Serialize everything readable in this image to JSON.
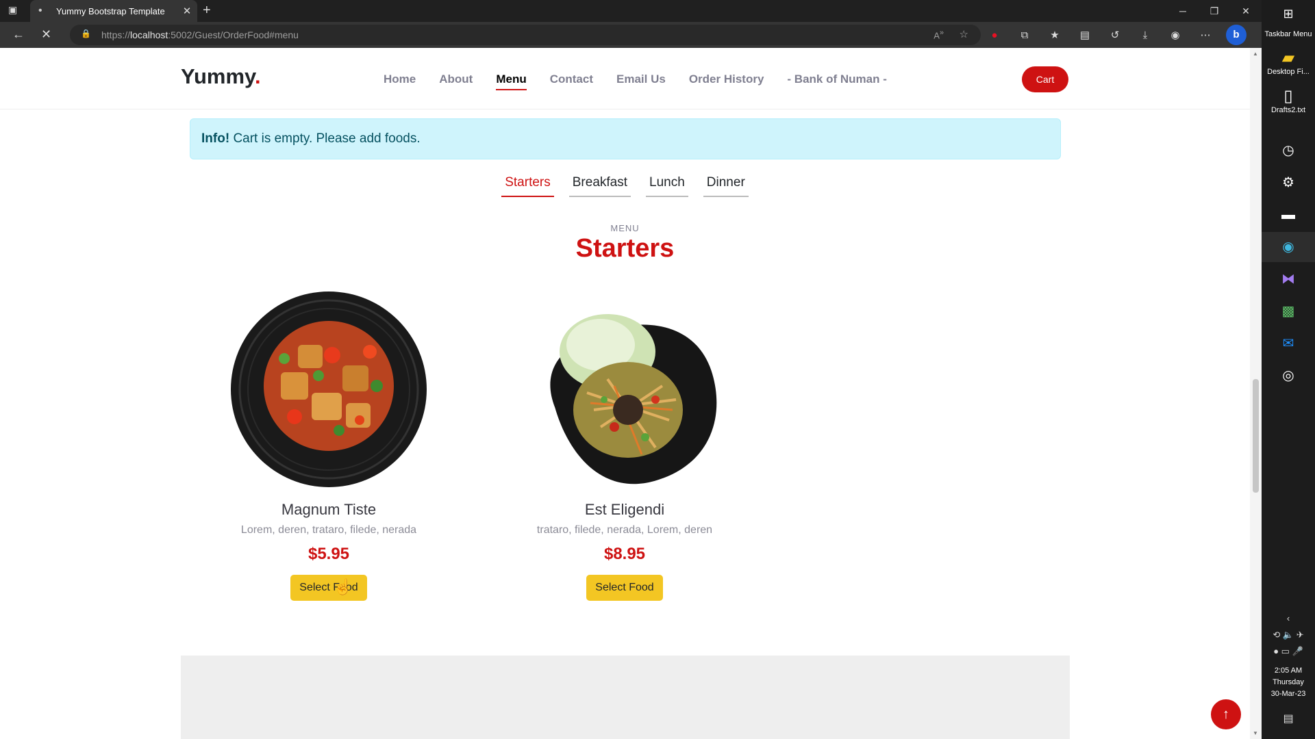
{
  "browser": {
    "tab_title": "Yummy Bootstrap Template",
    "url_prefix": "https://",
    "url_host": "localhost",
    "url_rest": ":5002/Guest/OrderFood#menu"
  },
  "site": {
    "logo_text": "Yummy",
    "logo_dot": ".",
    "nav": [
      {
        "label": "Home"
      },
      {
        "label": "About"
      },
      {
        "label": "Menu"
      },
      {
        "label": "Contact"
      },
      {
        "label": "Email Us"
      },
      {
        "label": "Order History"
      },
      {
        "label": "- Bank of Numan -"
      }
    ],
    "active_nav": "Menu",
    "cart_label": "Cart"
  },
  "alert": {
    "strong": "Info!",
    "text": "Cart is empty. Please add foods."
  },
  "menu_tabs": [
    {
      "label": "Starters"
    },
    {
      "label": "Breakfast"
    },
    {
      "label": "Lunch"
    },
    {
      "label": "Dinner"
    }
  ],
  "active_tab": "Starters",
  "section": {
    "subtitle": "MENU",
    "title": "Starters"
  },
  "foods": [
    {
      "name": "Magnum Tiste",
      "ingredients": "Lorem, deren, trataro, filede, nerada",
      "price": "$5.95",
      "button": "Select Food"
    },
    {
      "name": "Est Eligendi",
      "ingredients": "trataro, filede, nerada, Lorem, deren",
      "price": "$8.95",
      "button": "Select Food"
    }
  ],
  "taskbar": {
    "menu_label": "Taskbar Menu",
    "desktop_folder": "Desktop Fi...",
    "drafts_file": "Drafts2.txt",
    "time": "2:05 AM",
    "day": "Thursday",
    "date": "30-Mar-23"
  },
  "colors": {
    "accent": "#ce1212",
    "button_yellow": "#f3c623",
    "alert_bg": "#cff4fc"
  },
  "icons": {
    "back": "arrow-left-icon",
    "reload": "stop-loading-icon",
    "lock": "lock-icon",
    "scroll_top": "arrow-up-icon"
  }
}
